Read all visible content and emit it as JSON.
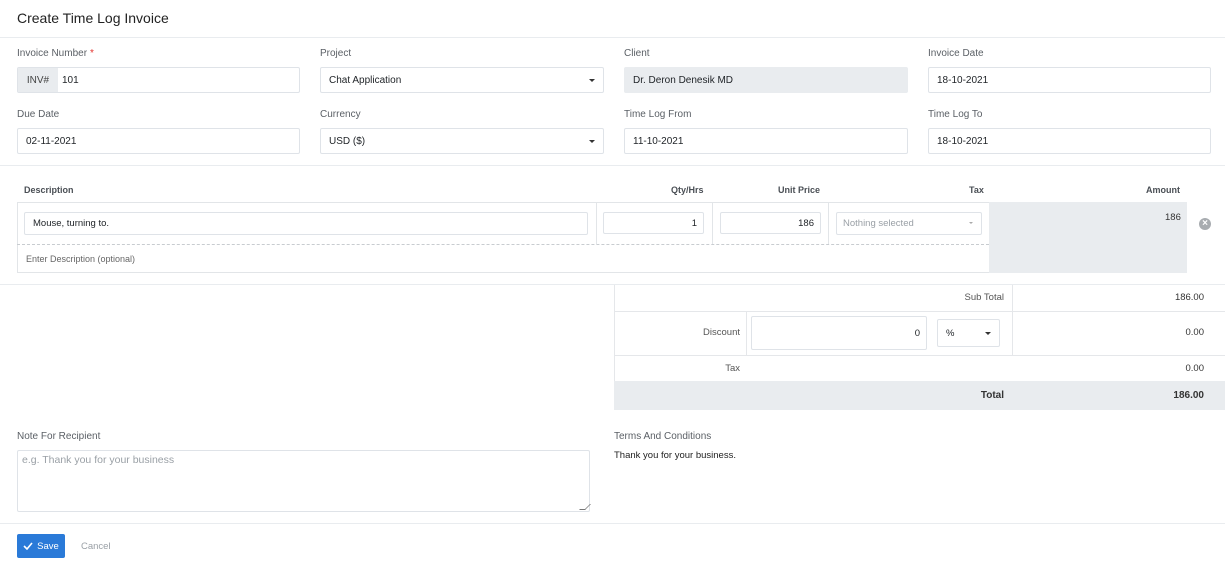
{
  "page": {
    "title": "Create Time Log Invoice"
  },
  "form": {
    "invoice_number": {
      "label": "Invoice Number",
      "required_mark": "*",
      "prefix": "INV#",
      "value": "101"
    },
    "project": {
      "label": "Project",
      "value": "Chat Application"
    },
    "client": {
      "label": "Client",
      "value": "Dr. Deron Denesik MD"
    },
    "invoice_date": {
      "label": "Invoice Date",
      "value": "18-10-2021"
    },
    "due_date": {
      "label": "Due Date",
      "value": "02-11-2021"
    },
    "currency": {
      "label": "Currency",
      "value": "USD ($)"
    },
    "time_log_from": {
      "label": "Time Log From",
      "value": "11-10-2021"
    },
    "time_log_to": {
      "label": "Time Log To",
      "value": "18-10-2021"
    }
  },
  "items": {
    "headers": {
      "description": "Description",
      "qty": "Qty/Hrs",
      "unit_price": "Unit Price",
      "tax": "Tax",
      "amount": "Amount"
    },
    "rows": [
      {
        "description": "Mouse, turning to.",
        "description_placeholder": "Enter Description (optional)",
        "qty": "1",
        "unit_price": "186",
        "tax_placeholder": "Nothing selected",
        "amount": "186"
      }
    ]
  },
  "totals": {
    "subtotal_label": "Sub Total",
    "subtotal_value": "186.00",
    "discount_label": "Discount",
    "discount_input": "0",
    "discount_type": "%",
    "discount_value": "0.00",
    "tax_label": "Tax",
    "tax_value": "0.00",
    "total_label": "Total",
    "total_value": "186.00"
  },
  "note": {
    "label": "Note For Recipient",
    "placeholder": "e.g. Thank you for your business"
  },
  "terms": {
    "label": "Terms And Conditions",
    "text": "Thank you for your business."
  },
  "actions": {
    "save_label": "Save",
    "cancel_label": "Cancel"
  },
  "colors": {
    "primary": "#2a7ad8",
    "required": "#e3342f",
    "disabled_bg": "#e9ecef"
  }
}
